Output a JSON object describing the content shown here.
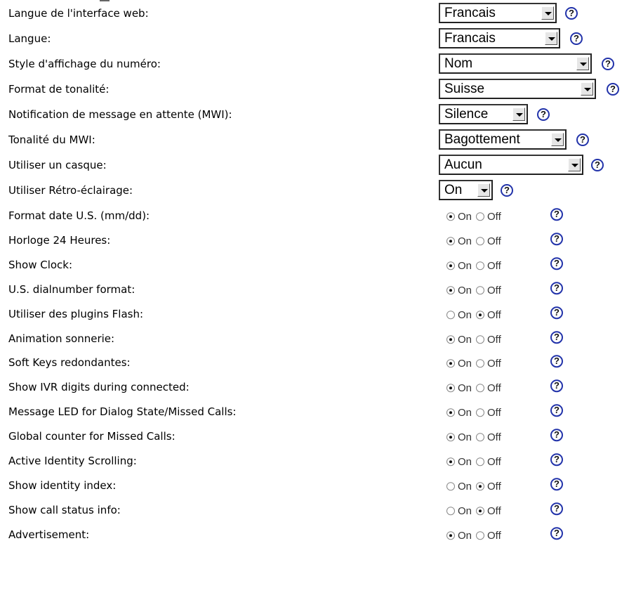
{
  "help_glyph": "?",
  "selects": [
    {
      "label": "Langue de l'interface web:",
      "value": "Francais"
    },
    {
      "label": "Langue:",
      "value": "Francais"
    },
    {
      "label": "Style d'affichage du numéro:",
      "value": "Nom"
    },
    {
      "label": "Format de tonalité:",
      "value": "Suisse"
    },
    {
      "label": "Notification de message en attente (MWI):",
      "value": "Silence"
    },
    {
      "label": "Tonalité du MWI:",
      "value": "Bagottement"
    },
    {
      "label": "Utiliser un casque:",
      "value": "Aucun"
    },
    {
      "label": "Utiliser Rétro-éclairage:",
      "value": "On"
    }
  ],
  "radio_on_label": "On",
  "radio_off_label": "Off",
  "toggles": [
    {
      "label": "Format date U.S. (mm/dd):",
      "selected": "on"
    },
    {
      "label": "Horloge 24 Heures:",
      "selected": "on"
    },
    {
      "label": "Show Clock:",
      "selected": "on"
    },
    {
      "label": "U.S. dialnumber format:",
      "selected": "on"
    },
    {
      "label": "Utiliser des plugins Flash:",
      "selected": "off"
    },
    {
      "label": "Animation sonnerie:",
      "selected": "on"
    },
    {
      "label": "Soft Keys redondantes:",
      "selected": "on"
    },
    {
      "label": "Show IVR digits during connected:",
      "selected": "on"
    },
    {
      "label": "Message LED for Dialog State/Missed Calls:",
      "selected": "on"
    },
    {
      "label": "Global counter for Missed Calls:",
      "selected": "on"
    },
    {
      "label": "Active Identity Scrolling:",
      "selected": "on"
    },
    {
      "label": "Show identity index:",
      "selected": "off"
    },
    {
      "label": "Show call status info:",
      "selected": "off"
    },
    {
      "label": "Advertisement:",
      "selected": "on"
    }
  ]
}
